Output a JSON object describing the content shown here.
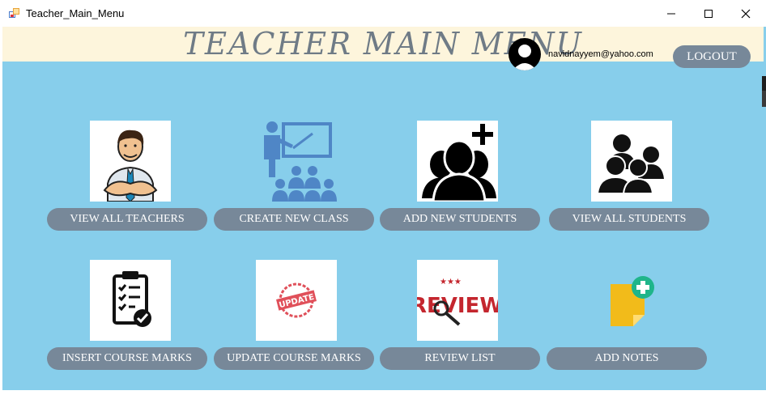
{
  "window": {
    "title": "Teacher_Main_Menu",
    "controls": {
      "minimize": "minimize-icon",
      "maximize": "maximize-icon",
      "close": "close-icon"
    }
  },
  "header": {
    "title": "TEACHER MAIN MENU"
  },
  "user": {
    "email": "navidnayyem@yahoo.com",
    "logout_label": "LOGOUT"
  },
  "menu": {
    "row1": [
      {
        "label": "VIEW ALL TEACHERS",
        "icon": "teacher-icon"
      },
      {
        "label": "CREATE NEW CLASS",
        "icon": "classroom-icon"
      },
      {
        "label": "ADD NEW STUDENTS",
        "icon": "add-students-icon"
      },
      {
        "label": "VIEW ALL STUDENTS",
        "icon": "students-group-icon"
      }
    ],
    "row2": [
      {
        "label": "INSERT COURSE MARKS",
        "icon": "checklist-icon"
      },
      {
        "label": "UPDATE COURSE MARKS",
        "icon": "update-stamp-icon",
        "icon_text": "UPDATE"
      },
      {
        "label": "REVIEW LIST",
        "icon": "review-icon",
        "icon_text": "REVIEW"
      },
      {
        "label": "ADD NOTES",
        "icon": "add-note-icon"
      }
    ]
  },
  "colors": {
    "background": "#87ceeb",
    "header_band": "#fdf5dc",
    "button": "#778899",
    "title_text": "#6f7b86"
  }
}
